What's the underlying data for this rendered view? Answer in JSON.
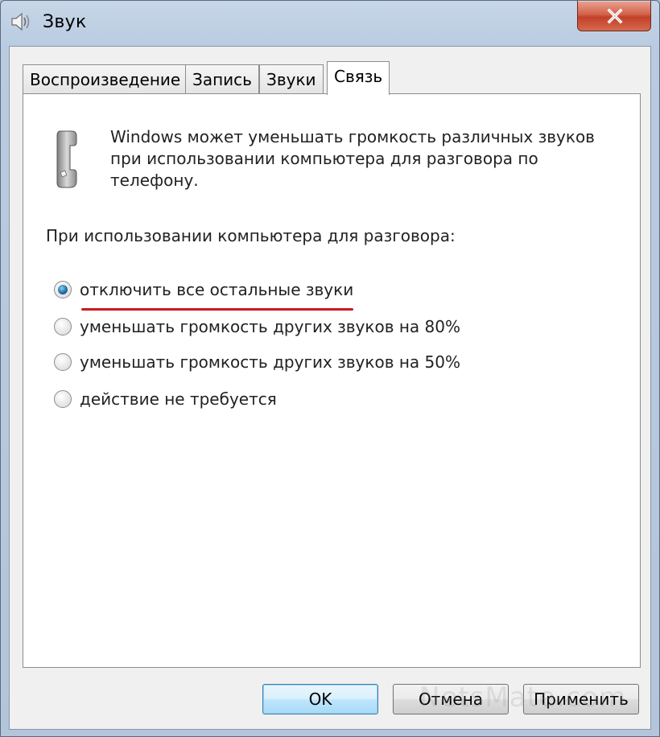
{
  "window": {
    "title": "Звук",
    "close_label": "Close"
  },
  "tabs": [
    {
      "label": "Воспроизведение",
      "active": false
    },
    {
      "label": "Запись",
      "active": false
    },
    {
      "label": "Звуки",
      "active": false
    },
    {
      "label": "Связь",
      "active": true
    }
  ],
  "panel": {
    "intro_line1": "Windows может уменьшать громкость различных звуков",
    "intro_line2": "при использовании компьютера для разговора по",
    "intro_line3": "телефону.",
    "question": "При использовании компьютера для разговора:",
    "options": [
      {
        "label": "отключить все остальные звуки",
        "checked": true
      },
      {
        "label": "уменьшать громкость других звуков на 80%",
        "checked": false
      },
      {
        "label": "уменьшать громкость других звуков на 50%",
        "checked": false
      },
      {
        "label": "действие не требуется",
        "checked": false
      }
    ]
  },
  "buttons": {
    "ok": "OK",
    "cancel": "Отмена",
    "apply": "Применить"
  },
  "watermark": "NetsMate.com",
  "colors": {
    "highlight_underline": "#cc1b1b",
    "default_button_border": "#3c7fb1",
    "radio_checked": "#1f6fa8"
  },
  "icons": {
    "title": "speaker-icon",
    "panel": "telephone-handset-icon",
    "close": "close-icon"
  }
}
